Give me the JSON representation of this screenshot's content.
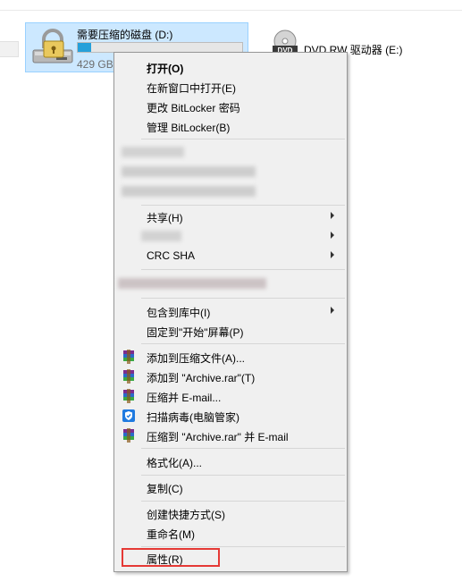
{
  "drive_d": {
    "name": "需要压缩的磁盘 (D:)",
    "free_space": "429 GB",
    "used_fraction": 0.08
  },
  "drive_e": {
    "name": "DVD RW 驱动器 (E:)",
    "badge": "DVD"
  },
  "context_menu": {
    "open": "打开(O)",
    "open_new_window": "在新窗口中打开(E)",
    "change_bitlocker_password": "更改 BitLocker 密码",
    "manage_bitlocker": "管理 BitLocker(B)",
    "share": "共享(H)",
    "crc_sha": "CRC SHA",
    "include_in_library": "包含到库中(I)",
    "pin_to_start": "固定到\"开始\"屏幕(P)",
    "add_to_archive": "添加到压缩文件(A)...",
    "add_to_archive_rar": "添加到 \"Archive.rar\"(T)",
    "compress_email": "压缩并 E-mail...",
    "scan_virus": "扫描病毒(电脑管家)",
    "compress_rar_email": "压缩到 \"Archive.rar\" 并 E-mail",
    "format": "格式化(A)...",
    "copy": "复制(C)",
    "create_shortcut": "创建快捷方式(S)",
    "rename": "重命名(M)",
    "properties": "属性(R)"
  },
  "colors": {
    "selection_bg": "#cce8ff",
    "highlight_box": "#e53935",
    "progress_fill": "#26a0da"
  }
}
